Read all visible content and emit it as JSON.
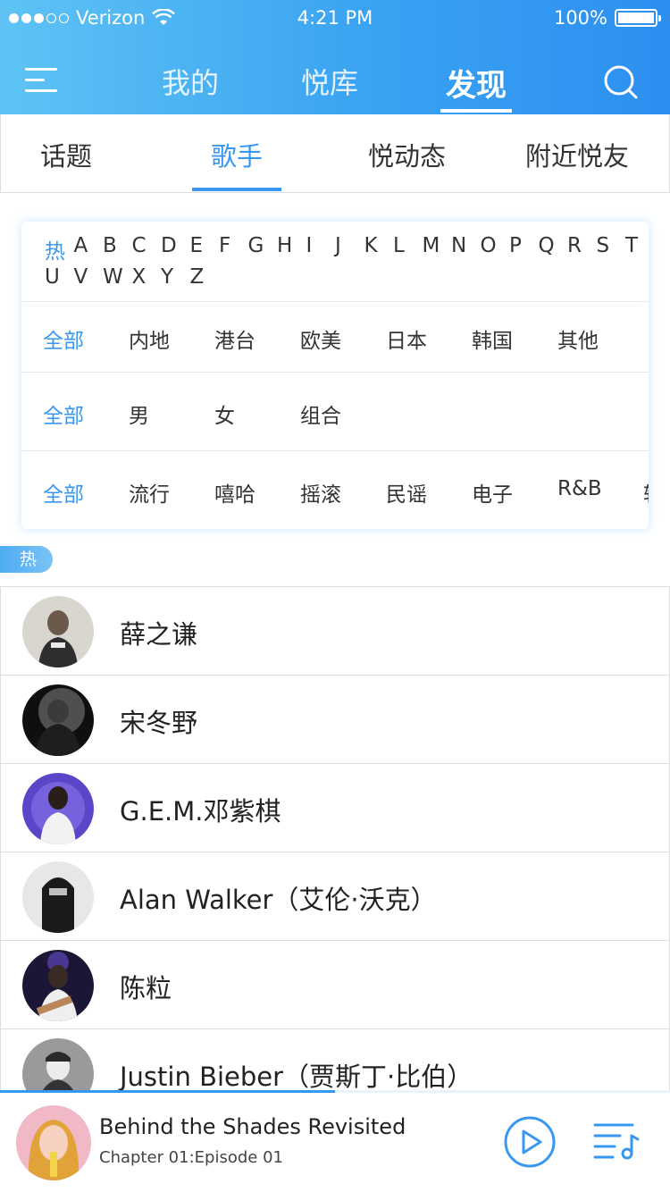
{
  "status_bar": {
    "carrier": "Verizon",
    "time": "4:21 PM",
    "battery": "100%",
    "signal_filled": 3,
    "signal_total": 5
  },
  "nav": {
    "tabs": [
      "我的",
      "悦库",
      "发现"
    ],
    "active_tab": "发现",
    "menu_icon": "hamburger-icon",
    "search_icon": "search-icon"
  },
  "subtabs": {
    "items": [
      "话题",
      "歌手",
      "悦动态",
      "附近悦友"
    ],
    "active": "歌手"
  },
  "filters": {
    "letters_row1": [
      "热",
      "A",
      "B",
      "C",
      "D",
      "E",
      "F",
      "G",
      "H",
      "I",
      "J",
      "K",
      "L",
      "M",
      "N",
      "O",
      "P",
      "Q",
      "R",
      "S",
      "T"
    ],
    "letters_row2": [
      "U",
      "V",
      "W",
      "X",
      "Y",
      "Z"
    ],
    "region": [
      "全部",
      "内地",
      "港台",
      "欧美",
      "日本",
      "韩国",
      "其他"
    ],
    "gender": [
      "全部",
      "男",
      "女",
      "组合"
    ],
    "genre": [
      "全部",
      "流行",
      "嘻哈",
      "摇滚",
      "民谣",
      "电子",
      "R&B",
      "轻"
    ]
  },
  "section_tag": "热",
  "artists": [
    {
      "name": "薛之谦"
    },
    {
      "name": "宋冬野"
    },
    {
      "name": "G.E.M.邓紫棋"
    },
    {
      "name": "Alan Walker（艾伦·沃克）"
    },
    {
      "name": "陈粒"
    },
    {
      "name": "Justin Bieber（贾斯丁·比伯）"
    }
  ],
  "player": {
    "title": "Behind the Shades Revisited",
    "subtitle": "Chapter 01:Episode 01",
    "progress": 0.5,
    "play_icon": "play-icon",
    "playlist_icon": "playlist-icon"
  },
  "colors": {
    "accent": "#3a97f0",
    "header_start": "#5ec3f4",
    "header_end": "#2c8ff0"
  }
}
